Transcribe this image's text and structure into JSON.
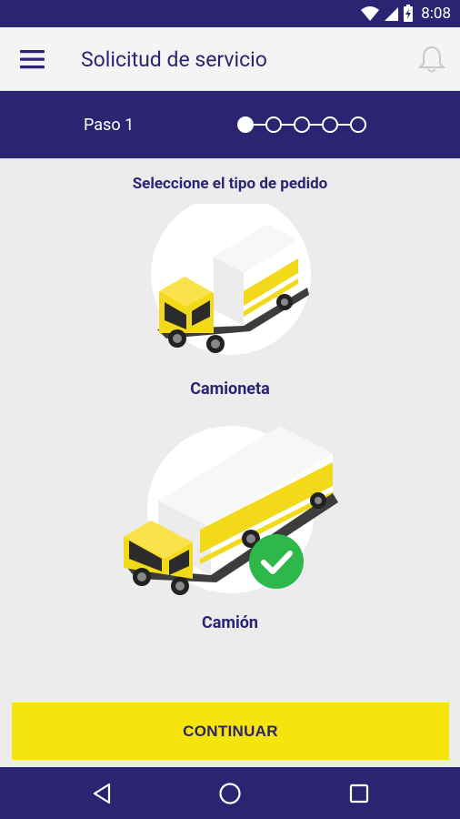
{
  "status_bar": {
    "time": "8:08"
  },
  "app_bar": {
    "title": "Solicitud de servicio"
  },
  "step": {
    "label": "Paso 1",
    "current": 1,
    "total": 5
  },
  "main": {
    "instruction": "Seleccione el tipo de pedido",
    "options": [
      {
        "label": "Camioneta",
        "selected": false
      },
      {
        "label": "Camión",
        "selected": true
      }
    ]
  },
  "footer": {
    "continue_label": "CONTINUAR"
  },
  "colors": {
    "brand_navy": "#2a2473",
    "accent_yellow": "#f6e40f",
    "check_green": "#2fb84a"
  }
}
